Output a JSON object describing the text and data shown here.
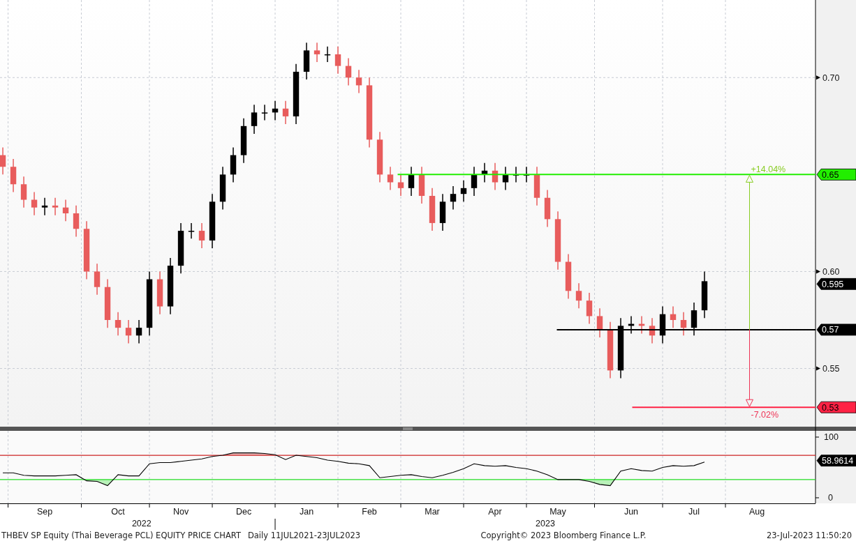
{
  "price_chart": {
    "chart_data": {
      "type": "candlestick",
      "grid": true,
      "ylim": [
        0.52,
        0.74
      ],
      "yticks": [
        {
          "value": 0.55,
          "label": "0.55"
        },
        {
          "value": 0.6,
          "label": "0.60"
        },
        {
          "value": 0.7,
          "label": "0.70"
        }
      ],
      "categories": [
        null,
        null,
        null,
        null,
        "Sep",
        null,
        null,
        null,
        null,
        null,
        null,
        "Oct",
        null,
        null,
        null,
        null,
        null,
        "Nov",
        null,
        null,
        null,
        null,
        null,
        "Dec",
        null,
        null,
        null,
        null,
        null,
        "Jan",
        null,
        null,
        null,
        null,
        null,
        "Feb",
        null,
        null,
        null,
        null,
        null,
        "Mar",
        null,
        null,
        null,
        null,
        null,
        "Apr",
        null,
        null,
        null,
        null,
        null,
        "May",
        null,
        null,
        null,
        null,
        null,
        null,
        "Jun",
        null,
        null,
        null,
        null,
        null,
        "Jul",
        null,
        null,
        null,
        null,
        null,
        "Aug",
        null,
        null,
        null,
        null,
        null
      ],
      "ohlc": [
        [
          0.66,
          0.664,
          0.65,
          0.654
        ],
        [
          0.654,
          0.658,
          0.641,
          0.645
        ],
        [
          0.645,
          0.649,
          0.633,
          0.637
        ],
        [
          0.637,
          0.641,
          0.629,
          0.633
        ],
        [
          0.633,
          0.638,
          0.629,
          0.634
        ],
        [
          0.634,
          0.638,
          0.629,
          0.633
        ],
        [
          0.633,
          0.637,
          0.626,
          0.63
        ],
        [
          0.63,
          0.634,
          0.618,
          0.622
        ],
        [
          0.622,
          0.626,
          0.596,
          0.6
        ],
        [
          0.6,
          0.604,
          0.588,
          0.592
        ],
        [
          0.592,
          0.596,
          0.571,
          0.575
        ],
        [
          0.575,
          0.579,
          0.567,
          0.571
        ],
        [
          0.571,
          0.575,
          0.563,
          0.567
        ],
        [
          0.567,
          0.575,
          0.563,
          0.571
        ],
        [
          0.571,
          0.6,
          0.567,
          0.596
        ],
        [
          0.596,
          0.6,
          0.578,
          0.582
        ],
        [
          0.582,
          0.607,
          0.578,
          0.603
        ],
        [
          0.603,
          0.625,
          0.599,
          0.621
        ],
        [
          0.621,
          0.625,
          0.617,
          0.621
        ],
        [
          0.621,
          0.625,
          0.612,
          0.616
        ],
        [
          0.616,
          0.64,
          0.612,
          0.636
        ],
        [
          0.636,
          0.654,
          0.632,
          0.65
        ],
        [
          0.65,
          0.664,
          0.646,
          0.66
        ],
        [
          0.66,
          0.679,
          0.656,
          0.675
        ],
        [
          0.675,
          0.686,
          0.671,
          0.682
        ],
        [
          0.682,
          0.686,
          0.678,
          0.682
        ],
        [
          0.682,
          0.688,
          0.678,
          0.684
        ],
        [
          0.684,
          0.688,
          0.676,
          0.68
        ],
        [
          0.68,
          0.707,
          0.676,
          0.703
        ],
        [
          0.703,
          0.718,
          0.699,
          0.714
        ],
        [
          0.714,
          0.718,
          0.708,
          0.712
        ],
        [
          0.712,
          0.716,
          0.708,
          0.712
        ],
        [
          0.712,
          0.716,
          0.702,
          0.706
        ],
        [
          0.706,
          0.71,
          0.696,
          0.7
        ],
        [
          0.7,
          0.704,
          0.692,
          0.696
        ],
        [
          0.696,
          0.7,
          0.664,
          0.668
        ],
        [
          0.668,
          0.672,
          0.646,
          0.65
        ],
        [
          0.65,
          0.654,
          0.642,
          0.646
        ],
        [
          0.646,
          0.65,
          0.639,
          0.643
        ],
        [
          0.643,
          0.654,
          0.639,
          0.65
        ],
        [
          0.65,
          0.654,
          0.635,
          0.639
        ],
        [
          0.639,
          0.643,
          0.621,
          0.625
        ],
        [
          0.625,
          0.64,
          0.621,
          0.636
        ],
        [
          0.636,
          0.644,
          0.632,
          0.64
        ],
        [
          0.64,
          0.647,
          0.636,
          0.643
        ],
        [
          0.643,
          0.654,
          0.639,
          0.65
        ],
        [
          0.65,
          0.656,
          0.646,
          0.652
        ],
        [
          0.652,
          0.656,
          0.642,
          0.646
        ],
        [
          0.646,
          0.654,
          0.642,
          0.65
        ],
        [
          0.65,
          0.654,
          0.646,
          0.65
        ],
        [
          0.65,
          0.654,
          0.646,
          0.65
        ],
        [
          0.65,
          0.654,
          0.634,
          0.638
        ],
        [
          0.638,
          0.642,
          0.623,
          0.627
        ],
        [
          0.627,
          0.631,
          0.601,
          0.605
        ],
        [
          0.605,
          0.609,
          0.586,
          0.59
        ],
        [
          0.59,
          0.594,
          0.581,
          0.585
        ],
        [
          0.585,
          0.589,
          0.573,
          0.577
        ],
        [
          0.577,
          0.581,
          0.566,
          0.57
        ],
        [
          0.57,
          0.574,
          0.545,
          0.549
        ],
        [
          0.549,
          0.576,
          0.545,
          0.572
        ],
        [
          0.572,
          0.577,
          0.568,
          0.573
        ],
        [
          0.573,
          0.577,
          0.568,
          0.572
        ],
        [
          0.572,
          0.576,
          0.563,
          0.567
        ],
        [
          0.567,
          0.582,
          0.563,
          0.578
        ],
        [
          0.578,
          0.582,
          0.571,
          0.575
        ],
        [
          0.575,
          0.579,
          0.567,
          0.571
        ],
        [
          0.571,
          0.584,
          0.567,
          0.58
        ],
        [
          0.58,
          0.6,
          0.576,
          0.595
        ],
        null,
        null,
        null,
        null,
        null,
        null,
        null,
        null,
        null,
        null
      ],
      "ref_lines": [
        {
          "axis": "y",
          "value": 0.65,
          "label": "0.65",
          "color": "#22ee00"
        },
        {
          "axis": "y",
          "value": 0.57,
          "label": "0.57",
          "color": "#000000"
        },
        {
          "axis": "y",
          "value": 0.53,
          "label": "0.53",
          "color": "#ff2244"
        }
      ],
      "annotations": [
        "0.595",
        {
          "text": "+14.04%",
          "y": 0.65
        },
        {
          "text": "-7.02%",
          "y": 0.53
        }
      ]
    },
    "years": [
      "2022",
      "2023"
    ]
  },
  "rsi_chart": {
    "chart_data": {
      "type": "line",
      "grid": true,
      "ylim": [
        -9.2,
        110.3
      ],
      "yticks": [
        0,
        100
      ],
      "series": [
        {
          "color": "#000000",
          "values": [
            41,
            41,
            37,
            36,
            36,
            36,
            37,
            38,
            28,
            27,
            20,
            38,
            36,
            36,
            56,
            58,
            58,
            60,
            62,
            64,
            68,
            70,
            74,
            74,
            74,
            73,
            71,
            63,
            70,
            68,
            66,
            62,
            60,
            57,
            56,
            53,
            33,
            35,
            37,
            38,
            35,
            33,
            37,
            42,
            48,
            56,
            53,
            52,
            53,
            50,
            48,
            44,
            38,
            30,
            30,
            30,
            27,
            22,
            20,
            44,
            48,
            45,
            44,
            50,
            53,
            52,
            53,
            59,
            null,
            null,
            null,
            null,
            null,
            null,
            null,
            null,
            null,
            null
          ]
        }
      ],
      "ref_lines": [
        {
          "axis": "y",
          "value": 70,
          "color": "#cc2222"
        },
        {
          "axis": "y",
          "value": 30,
          "color": "#22dd22"
        }
      ],
      "annotations": [
        "58.9614"
      ]
    }
  },
  "footer": {
    "title": "THBEV SP Equity (Thai Beverage PCL) EQUITY PRICE CHART",
    "range": "Daily 11JUL2021-23JUL2023",
    "copyright": "Copyright© 2023 Bloomberg Finance L.P.",
    "timestamp": "23-Jul-2023 11:50:20"
  }
}
